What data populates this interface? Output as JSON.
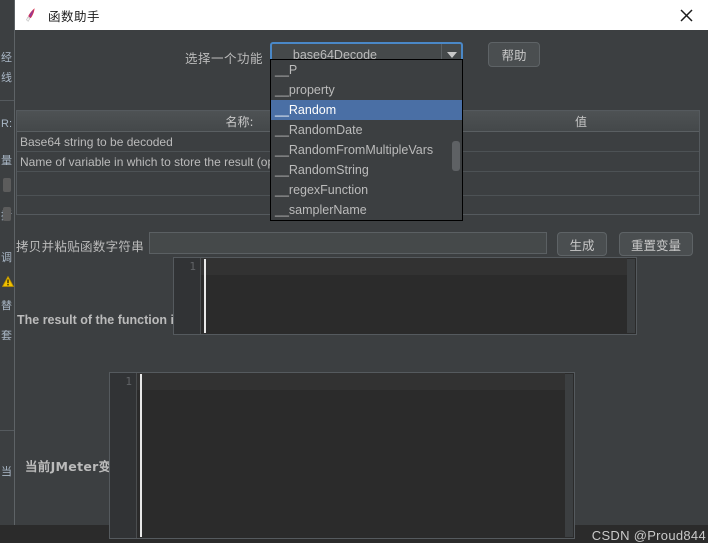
{
  "background_app": {
    "left_strip_chars": [
      "经",
      "线",
      "R:",
      "量",
      "拷",
      "调",
      "替",
      "套",
      "当"
    ],
    "warning_icon": "warning-triangle-icon"
  },
  "window": {
    "title": "函数助手",
    "icon": "jmeter-feather-icon",
    "close_label": "✕"
  },
  "function_row": {
    "label": "选择一个功能",
    "selected_value": "__base64Decode",
    "dropdown_arrow": "chevron-down-icon",
    "help_label": "帮助"
  },
  "dropdown": {
    "open": true,
    "items": [
      {
        "label": "__P",
        "selected": false
      },
      {
        "label": "__property",
        "selected": false
      },
      {
        "label": "__Random",
        "selected": true
      },
      {
        "label": "__RandomDate",
        "selected": false
      },
      {
        "label": "__RandomFromMultipleVars",
        "selected": false
      },
      {
        "label": "__RandomString",
        "selected": false
      },
      {
        "label": "__regexFunction",
        "selected": false
      },
      {
        "label": "__samplerName",
        "selected": false
      }
    ]
  },
  "params_table": {
    "columns": [
      "名称:",
      "值"
    ],
    "rows": [
      {
        "name": "Base64 string to be decoded",
        "value": ""
      },
      {
        "name": "Name of variable in which to store the result (optional)",
        "value": ""
      }
    ]
  },
  "paste_row": {
    "label": "拷贝并粘贴函数字符串",
    "input_value": "",
    "input_placeholder": "",
    "generate_label": "生成",
    "reset_label": "重置变量"
  },
  "result_section": {
    "label": "The result of the function is",
    "editor_line_number": "1",
    "editor_content": ""
  },
  "vars_section": {
    "label": "当前JMeter变量",
    "editor_line_number": "1",
    "editor_content": ""
  },
  "watermark": {
    "text": "CSDN @Proud844"
  },
  "colors": {
    "window_bg": "#3c3f41",
    "titlebar_bg": "#ffffff",
    "editor_bg": "#2b2b2b",
    "accent_focus": "#4a88c7",
    "selection": "#4a6fa5",
    "text": "#bbbbbb"
  }
}
